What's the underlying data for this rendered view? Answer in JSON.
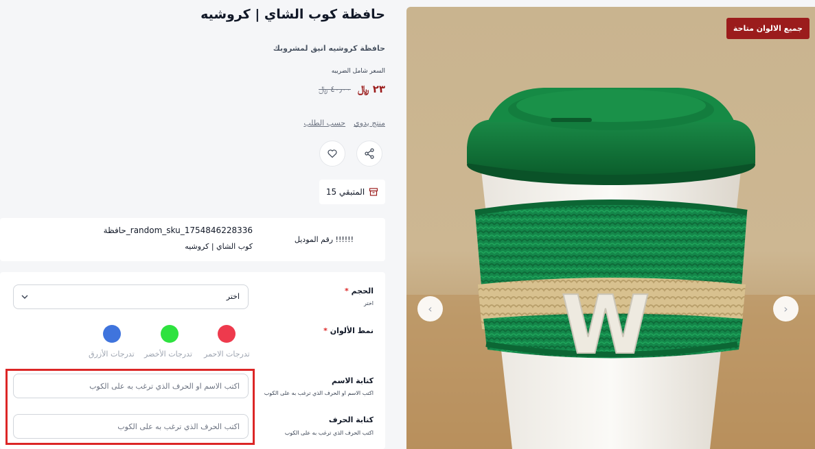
{
  "gallery": {
    "badge": "جميع الالوان متاحة",
    "cup_letter": "W",
    "prev_label": "‹",
    "next_label": "›"
  },
  "product": {
    "title": "حافظة كوب الشاي | كروشيه",
    "subtitle": "حافظة كروشيه انيق لمشروبك",
    "tax_label": "السعر شامل الضريبه",
    "price_new": "٢٣ ﷼",
    "price_old": "٤٠٫٠٠ ﷼",
    "tags": [
      "منتج يدوي",
      "حسب الطلب"
    ],
    "stock_text": "المتبقي 15"
  },
  "model": {
    "label": "!!!!!! رقم الموديل",
    "sku": "حافظة_random_sku_1754846228336",
    "name": "كوب الشاي | كروشيه"
  },
  "options": {
    "size": {
      "label": "الحجم",
      "required": "*",
      "hint": "اختر",
      "value": "اختر"
    },
    "colors": {
      "label": "نمط الألوان",
      "required": "*",
      "items": [
        {
          "label": "تدرجات الاحمر",
          "color": "#ee3a4d"
        },
        {
          "label": "تدرجات الأخضر",
          "color": "#2ee23f"
        },
        {
          "label": "تدرجات الأزرق",
          "color": "#3f74dd"
        }
      ]
    },
    "name_text": {
      "label": "كتابة الاسم",
      "hint": "اكتب الاسم او الحرف الذي ترغب به على الكوب",
      "placeholder": "اكتب الاسم او الحرف الذي ترغب به على الكوب"
    },
    "letter_text": {
      "label": "كتابة الحرف",
      "hint": "اكتب الحرف الذي ترغب به على الكوب",
      "placeholder": "اكتب الحرف الذي ترغب به على الكوب"
    }
  },
  "colors": {
    "accent": "#9b1c1c",
    "lid_green": "#0f7a3a",
    "sleeve_green": "#14874a",
    "stripe_beige": "#d7c08c",
    "highlight": "#dc2626"
  }
}
